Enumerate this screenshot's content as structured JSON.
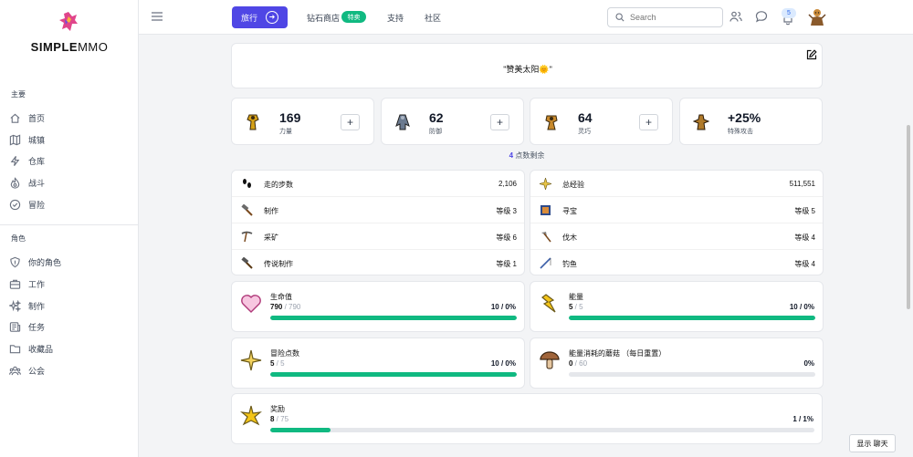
{
  "brand": {
    "name_bold": "SIMPLE",
    "name_light": "MMO"
  },
  "sidebar": {
    "sections": [
      {
        "heading": "主要",
        "items": [
          {
            "label": "首页",
            "icon": "home-icon"
          },
          {
            "label": "城镇",
            "icon": "map-icon"
          },
          {
            "label": "仓库",
            "icon": "bolt-icon"
          },
          {
            "label": "战斗",
            "icon": "fire-icon"
          },
          {
            "label": "冒险",
            "icon": "check-circle-icon"
          }
        ]
      },
      {
        "heading": "角色",
        "items": [
          {
            "label": "你的角色",
            "icon": "shield-icon"
          },
          {
            "label": "工作",
            "icon": "briefcase-icon"
          },
          {
            "label": "制作",
            "icon": "sparkles-icon"
          },
          {
            "label": "任务",
            "icon": "newspaper-icon"
          },
          {
            "label": "收藏品",
            "icon": "folder-icon"
          },
          {
            "label": "公会",
            "icon": "users-icon"
          }
        ]
      }
    ]
  },
  "topbar": {
    "travel_label": "旅行",
    "diamond_store": "钻石商店",
    "diamond_badge": "特卖",
    "support": "支持",
    "community": "社区",
    "search_placeholder": "Search",
    "notification_count": "5"
  },
  "motto": "\"赞美太阳🌞\"",
  "stats": [
    {
      "value": "169",
      "label": "力量"
    },
    {
      "value": "62",
      "label": "防御"
    },
    {
      "value": "64",
      "label": "灵巧"
    },
    {
      "value": "+25%",
      "label": "特殊攻击"
    }
  ],
  "points_remaining": {
    "count": "4",
    "label": "点数剩余"
  },
  "left_list": [
    {
      "label": "走的步数",
      "value": "2,106",
      "icon": "footsteps-icon"
    },
    {
      "label": "制作",
      "value": "等级 3",
      "icon": "hammer-icon"
    },
    {
      "label": "采矿",
      "value": "等级 6",
      "icon": "pickaxe-icon"
    },
    {
      "label": "传说制作",
      "value": "等级 1",
      "icon": "legendary-hammer-icon"
    }
  ],
  "right_list": [
    {
      "label": "总经验",
      "value": "511,551",
      "icon": "star-burst-icon"
    },
    {
      "label": "寻宝",
      "value": "等级 5",
      "icon": "treasure-map-icon"
    },
    {
      "label": "伐木",
      "value": "等级 4",
      "icon": "axe-icon"
    },
    {
      "label": "钓鱼",
      "value": "等级 4",
      "icon": "fishing-rod-icon"
    }
  ],
  "bars": {
    "health": {
      "label": "生命值",
      "current": "790",
      "max": " / 790",
      "pct": "10 / 0%",
      "fill": 1.0
    },
    "energy": {
      "label": "能量",
      "current": "5",
      "max": " / 5",
      "pct": "10 / 0%",
      "fill": 1.0
    },
    "quest_points": {
      "label": "冒险点数",
      "current": "5",
      "max": " / 5",
      "pct": "10 / 0%",
      "fill": 1.0
    },
    "mushrooms": {
      "label": "能量消耗的蘑菇  （每日重置）",
      "current": "0",
      "max": " / 60",
      "pct": "0%",
      "fill": 0.0
    },
    "reward": {
      "label": "奖励",
      "current": "8",
      "max": " / 75",
      "pct": "1 / 1%",
      "fill": 0.11
    }
  },
  "chat_button": "显示 聊天",
  "colors": {
    "accent": "#4f46e5",
    "progress": "#10b981"
  }
}
